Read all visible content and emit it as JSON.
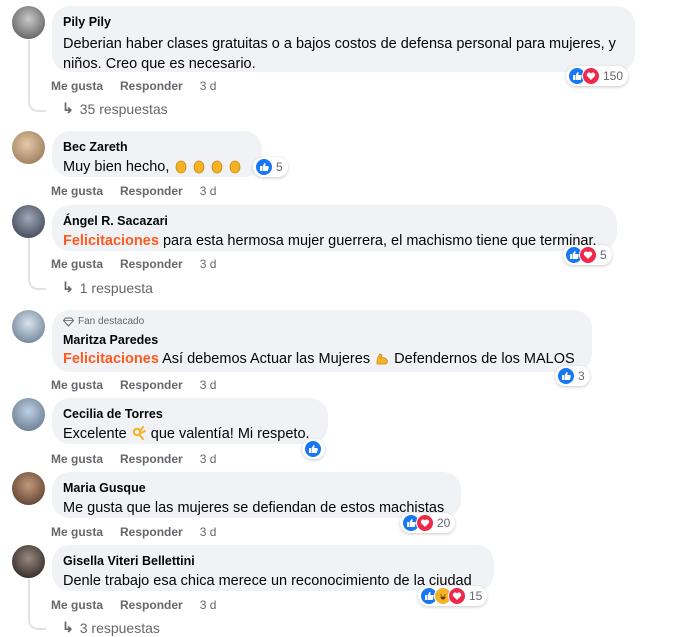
{
  "actions": {
    "like": "Me gusta",
    "reply": "Responder"
  },
  "comments": [
    {
      "author": "Pily Pily",
      "text": "Deberian haber clases gratuitas o a bajos costos de defensa personal para mujeres, y niños. Creo que es necesario.",
      "time": "3 d",
      "reaction_count": "150",
      "reactions": [
        "like",
        "love"
      ],
      "replies": "35 respuestas"
    },
    {
      "author": "Bec Zareth",
      "text": "Muy bien hecho,",
      "time": "3 d",
      "reaction_count": "5",
      "reactions": [
        "like"
      ]
    },
    {
      "author": "Ángel R. Sacazari",
      "highlight": "Felicitaciones",
      "text": "para esta hermosa mujer guerrera, el machismo tiene que terminar.",
      "time": "3 d",
      "reaction_count": "5",
      "reactions": [
        "like",
        "love"
      ],
      "replies": "1 respuesta"
    },
    {
      "badge": "Fan destacado",
      "author": "Maritza Paredes",
      "highlight": "Felicitaciones",
      "text_a": "Así debemos Actuar las Mujeres",
      "text_b": "Defendernos de los MALOS",
      "time": "3 d",
      "reaction_count": "3",
      "reactions": [
        "like"
      ]
    },
    {
      "author": "Cecilia de Torres",
      "text_a": "Excelente",
      "text_b": "que valentía! Mi respeto.",
      "time": "3 d",
      "reactions": [
        "like"
      ]
    },
    {
      "author": "Maria Gusque",
      "text": "Me gusta que las mujeres se defiendan de estos machistas",
      "time": "3 d",
      "reaction_count": "20",
      "reactions": [
        "like",
        "love"
      ]
    },
    {
      "author": "Gisella Viteri Bellettini",
      "text": "Denle trabajo esa chica merece un reconocimiento de la ciudad",
      "time": "3 d",
      "reaction_count": "15",
      "reactions": [
        "like",
        "haha",
        "love"
      ],
      "replies": "3 respuestas"
    }
  ],
  "colors": {
    "highlight": "#ff5a1f",
    "bubble": "#f0f2f5",
    "like": "#1877f2",
    "love": "#f02849",
    "haha": "#f7b125"
  }
}
